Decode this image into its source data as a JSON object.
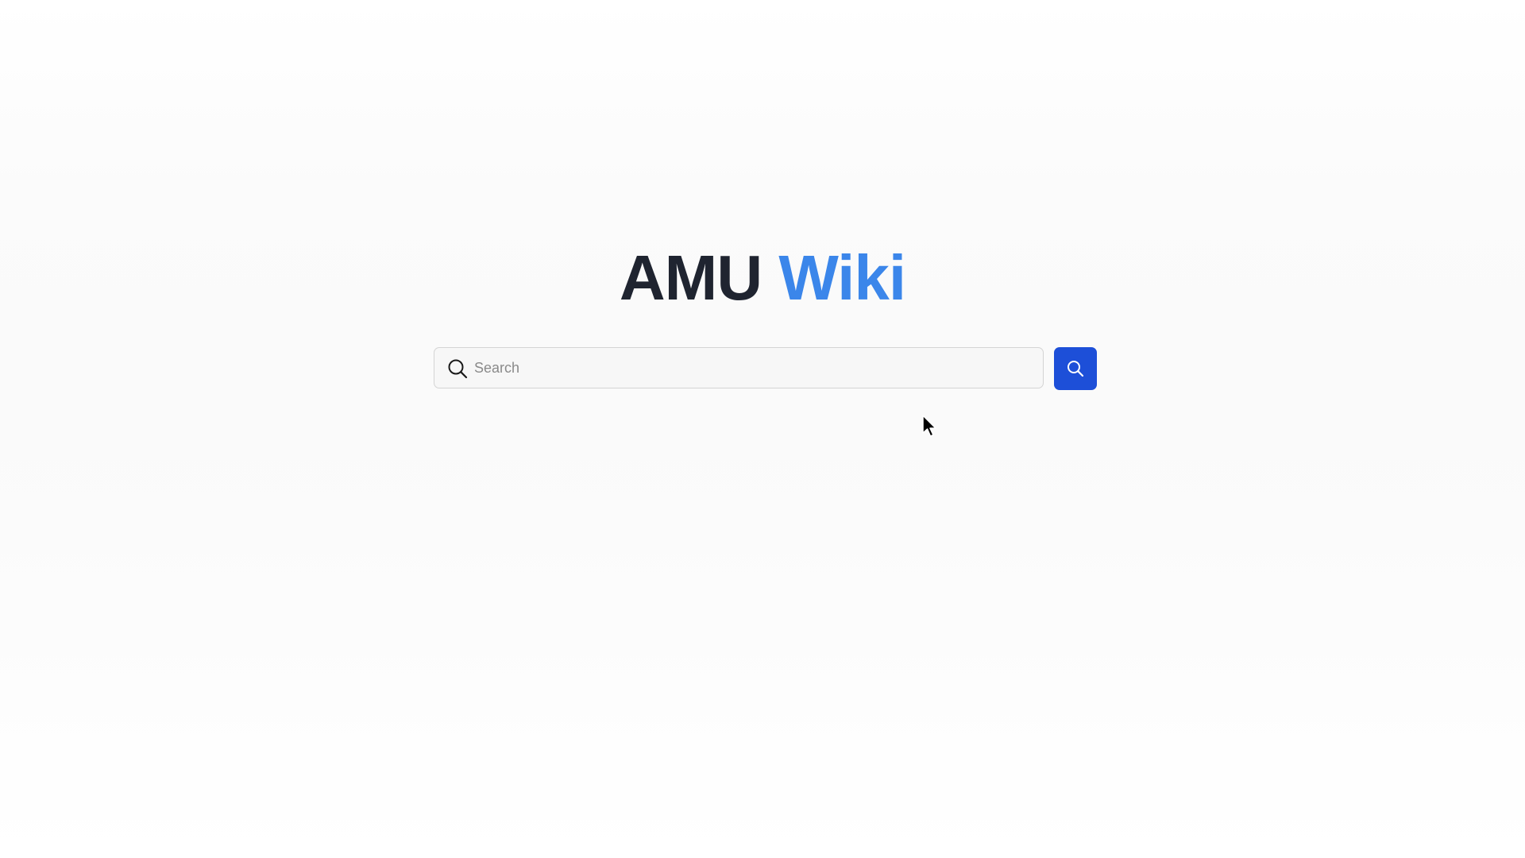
{
  "brand": {
    "part1": "AMU",
    "part2": "Wiki",
    "dark_color": "#1f2430",
    "accent_color": "#3b86ea"
  },
  "search": {
    "placeholder": "Search",
    "value": "",
    "leading_icon": "search-icon",
    "button_icon": "search-icon",
    "button_color": "#1d4fd8"
  },
  "cursor": {
    "icon": "mouse-pointer-icon"
  }
}
